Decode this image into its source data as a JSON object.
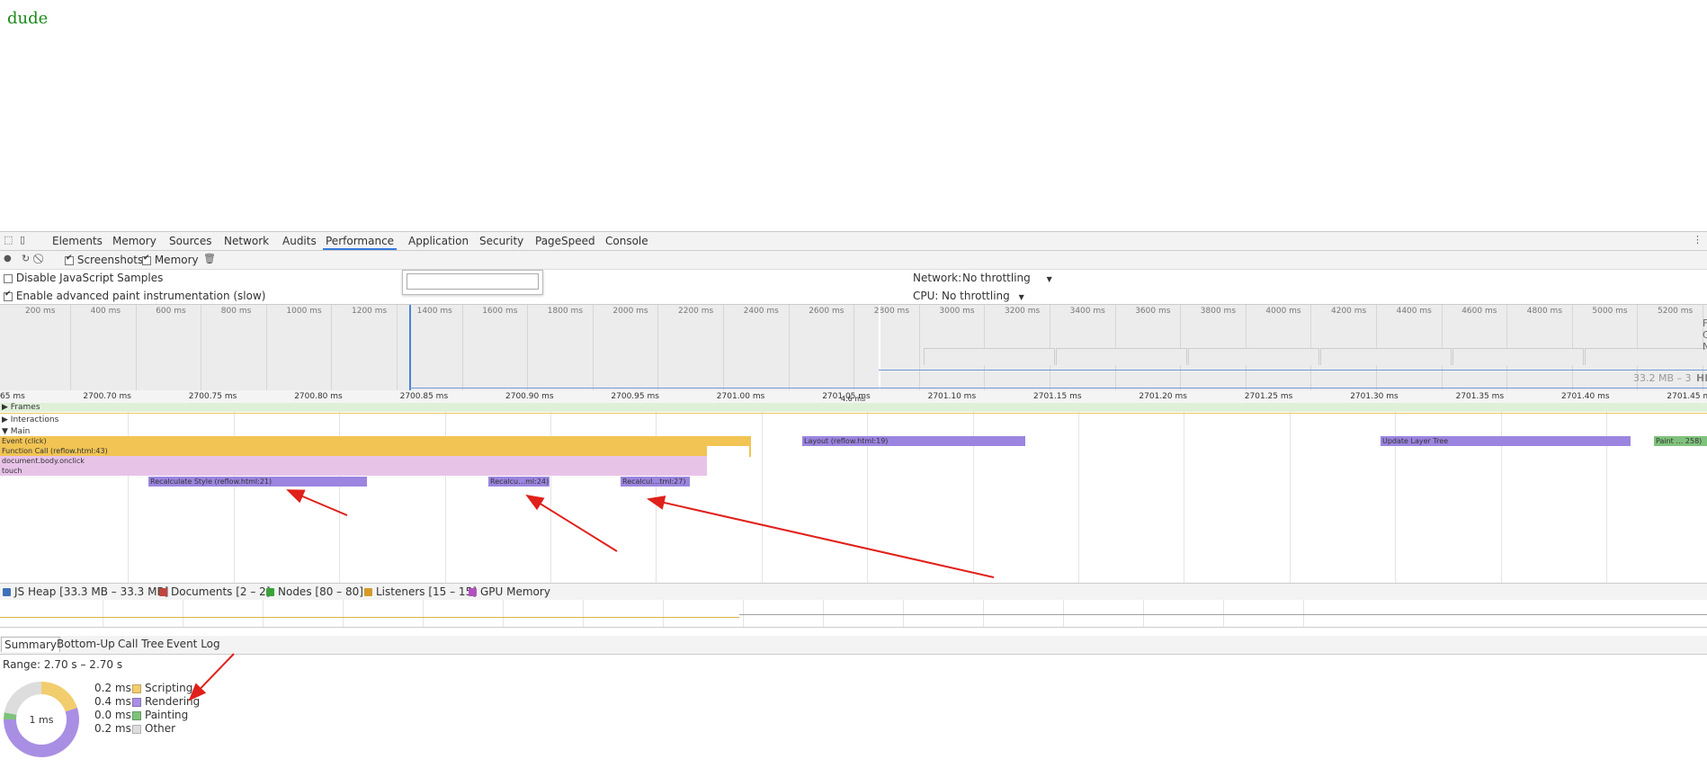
{
  "page": {
    "text": "dude"
  },
  "devtools": {
    "tabs": [
      "Elements",
      "Memory",
      "Sources",
      "Network",
      "Audits",
      "Performance",
      "Application",
      "Security",
      "PageSpeed",
      "Console"
    ],
    "active_tab": "Performance",
    "toolbar": {
      "screenshots_label": "Screenshots",
      "screenshots_checked": true,
      "memory_label": "Memory",
      "memory_checked": true
    },
    "settings": {
      "disable_js_samples": "Disable JavaScript Samples",
      "advanced_paint": "Enable advanced paint instrumentation (slow)",
      "network_label": "Network:",
      "network_value": "No throttling",
      "cpu_label": "CPU:",
      "cpu_value": "No throttling"
    },
    "overview": {
      "ticks": [
        "200 ms",
        "400 ms",
        "600 ms",
        "800 ms",
        "1000 ms",
        "1200 ms",
        "1400 ms",
        "1600 ms",
        "1800 ms",
        "2000 ms",
        "2200 ms",
        "2400 ms",
        "2600 ms",
        "2800 ms",
        "3000 ms",
        "3200 ms",
        "3400 ms",
        "3600 ms",
        "3800 ms",
        "4000 ms",
        "4200 ms",
        "4400 ms",
        "4600 ms",
        "4800 ms",
        "5000 ms",
        "5200 ms"
      ],
      "heap_readout": "33.2 MB – 3",
      "side_labels": [
        "F",
        "C",
        "N",
        "HE"
      ]
    },
    "ruler": {
      "ticks": [
        "65 ms",
        "2700.70 ms",
        "2700.75 ms",
        "2700.80 ms",
        "2700.85 ms",
        "2700.90 ms",
        "2700.95 ms",
        "2701.00 ms",
        "2701.05 ms",
        "2701.10 ms",
        "2701.15 ms",
        "2701.20 ms",
        "2701.25 ms",
        "2701.30 ms",
        "2701.35 ms",
        "2701.40 ms",
        "2701.45 ms"
      ],
      "frame_duration": "4.6 ms"
    },
    "tracks": {
      "frames": "Frames",
      "interactions": "Interactions",
      "main": "Main"
    },
    "flame_events": [
      {
        "label": "Event (click)",
        "kind": "scripting"
      },
      {
        "label": "Function Call (reflow.html:43)",
        "kind": "scripting"
      },
      {
        "label": "document.body.onclick",
        "kind": "js"
      },
      {
        "label": "touch",
        "kind": "js"
      },
      {
        "label": "Recalculate Style (reflow.html:21)",
        "kind": "rendering"
      },
      {
        "label": "Recalcu…ml:24)",
        "kind": "rendering"
      },
      {
        "label": "Recalcul…tml:27)",
        "kind": "rendering"
      },
      {
        "label": "Layout (reflow.html:19)",
        "kind": "rendering"
      },
      {
        "label": "Update Layer Tree",
        "kind": "rendering"
      },
      {
        "label": "Paint … 258)",
        "kind": "painting"
      }
    ],
    "counters": [
      {
        "label": "JS Heap [33.3 MB – 33.3 MB]",
        "color": "#3f6fb9",
        "checked": true
      },
      {
        "label": "Documents [2 – 2]",
        "color": "#c0463f",
        "checked": true
      },
      {
        "label": "Nodes [80 – 80]",
        "color": "#3aa33a",
        "checked": true
      },
      {
        "label": "Listeners [15 – 15]",
        "color": "#d49b2a",
        "checked": true
      },
      {
        "label": "GPU Memory",
        "color": "#b24fbe",
        "checked": true
      }
    ],
    "bottom_tabs": [
      "Summary",
      "Bottom-Up",
      "Call Tree",
      "Event Log"
    ],
    "active_bottom_tab": "Summary",
    "summary": {
      "range": "Range: 2.70 s – 2.70 s",
      "center_label": "1 ms",
      "rows": [
        {
          "value": "0.2 ms",
          "label": "Scripting",
          "color": "#f2cd6e",
          "fraction": 0.2
        },
        {
          "value": "0.4 ms",
          "label": "Rendering",
          "color": "#a98fe3",
          "fraction": 0.55
        },
        {
          "value": "0.0 ms",
          "label": "Painting",
          "color": "#7fc27c",
          "fraction": 0.03
        },
        {
          "value": "0.2 ms",
          "label": "Other",
          "color": "#dddddd",
          "fraction": 0.22
        }
      ]
    }
  },
  "colors": {
    "scripting": "#f1c453",
    "js": "#e8c3e8",
    "rendering": "#9b85e0",
    "painting": "#7fc27c",
    "annotation_arrow": "#e0201a"
  }
}
